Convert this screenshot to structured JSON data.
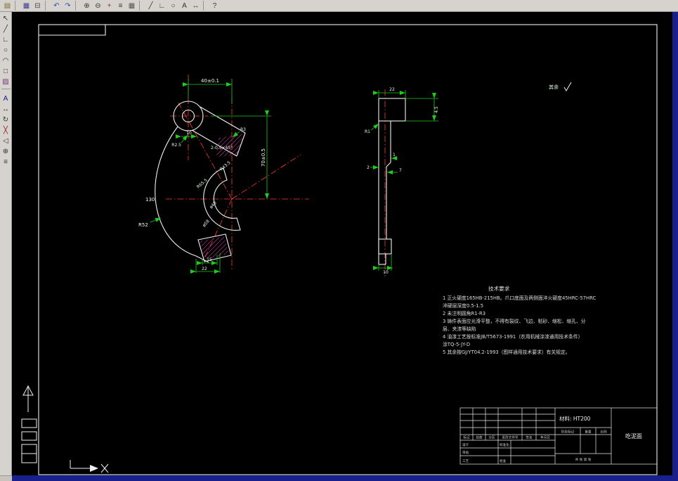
{
  "app": {
    "canvas_bg": "#000000",
    "toolbar_bg": "#d6d3ce",
    "window_edge_color": "#1a1f8e",
    "outline_color": "#f0f0f0",
    "dimension_color": "#1ecb1e",
    "centerline_color": "#ff3b30",
    "hatch_color": "#ff4fd1"
  },
  "toolbar_top": {
    "icons": [
      {
        "name": "open-icon",
        "glyph": "▤",
        "color": "#7a6a2a"
      },
      {
        "name": "separator"
      },
      {
        "name": "save-icon",
        "glyph": "▦",
        "color": "#3a3a8c"
      },
      {
        "name": "print-icon",
        "glyph": "⊟",
        "color": "#44475a"
      },
      {
        "name": "separator"
      },
      {
        "name": "undo-icon",
        "glyph": "↶",
        "color": "#2a52be"
      },
      {
        "name": "redo-icon",
        "glyph": "↷",
        "color": "#2a52be"
      },
      {
        "name": "separator"
      },
      {
        "name": "zoom-in-icon",
        "glyph": "⊕",
        "color": "#333333"
      },
      {
        "name": "zoom-out-icon",
        "glyph": "⊖",
        "color": "#333333"
      },
      {
        "name": "pan-icon",
        "glyph": "+",
        "color": "#a03333"
      },
      {
        "name": "layers-icon",
        "glyph": "≡",
        "color": "#333333"
      },
      {
        "name": "grid-icon",
        "glyph": "▦",
        "color": "#555555"
      },
      {
        "name": "separator"
      },
      {
        "name": "line-icon",
        "glyph": "╱",
        "color": "#333333"
      },
      {
        "name": "polyline-icon",
        "glyph": "∟",
        "color": "#333333"
      },
      {
        "name": "circle-icon",
        "glyph": "○",
        "color": "#333333"
      },
      {
        "name": "text-icon",
        "glyph": "A",
        "color": "#333333"
      },
      {
        "name": "dimension-icon",
        "glyph": "↔",
        "color": "#333333"
      },
      {
        "name": "separator"
      },
      {
        "name": "help-icon",
        "glyph": "?",
        "color": "#333333"
      }
    ]
  },
  "toolbar_left": {
    "icons": [
      {
        "name": "select-icon",
        "glyph": "↖",
        "color": "#333333"
      },
      {
        "name": "line-tool-icon",
        "glyph": "╱",
        "color": "#333333"
      },
      {
        "name": "polyline-tool-icon",
        "glyph": "∟",
        "color": "#333333"
      },
      {
        "name": "circle-tool-icon",
        "glyph": "○",
        "color": "#333333"
      },
      {
        "name": "arc-tool-icon",
        "glyph": "◠",
        "color": "#333333"
      },
      {
        "name": "rect-tool-icon",
        "glyph": "□",
        "color": "#333333"
      },
      {
        "name": "hatch-tool-icon",
        "glyph": "▨",
        "color": "#7a3a7a"
      },
      {
        "name": "separator"
      },
      {
        "name": "text-tool-icon",
        "glyph": "A",
        "color": "#1a1a8c"
      },
      {
        "name": "move-tool-icon",
        "glyph": "↔",
        "color": "#333333"
      },
      {
        "name": "rotate-tool-icon",
        "glyph": "↻",
        "color": "#333333"
      },
      {
        "name": "erase-tool-icon",
        "glyph": "╳",
        "color": "#8c1a1a"
      },
      {
        "name": "mirror-tool-icon",
        "glyph": "◁",
        "color": "#333333"
      },
      {
        "name": "zoom-tool-icon",
        "glyph": "⊕",
        "color": "#333333"
      },
      {
        "name": "props-tool-icon",
        "glyph": "≡",
        "color": "#333333"
      }
    ]
  },
  "drawing": {
    "front_view": {
      "labels": {
        "d40": "40±0.1",
        "d10": "10",
        "r3": "R3",
        "r25": "R2.5",
        "chamfer": "2-0.5×45°",
        "d70": "70±0.5",
        "r435": "R43.5",
        "r655": "R65.5",
        "dia40": "ø40",
        "dia58": "ø58",
        "d130": "130",
        "r52": "R52",
        "d15": "15",
        "d22": "22"
      }
    },
    "side_view": {
      "labels": {
        "d22": "22",
        "d45": "4.5",
        "r1": "R1",
        "d1": "1",
        "d2": "2",
        "d7": "7",
        "d10": "10"
      }
    },
    "surface_note": {
      "text": "其余"
    },
    "tech_requirements": {
      "title": "技术要求",
      "lines": [
        "1 正火硬度165HB-215HB。爪口底面及两侧面淬火硬度45HRC-57HRC",
        "  淬硬层深度0.5-1.5",
        "2 未注明圆角R1-R3",
        "3 铸件表面应光滑平整，不得有裂纹、飞边、粘砂、缩松、缩孔、分",
        "  层、夹渣等缺陷",
        "4 油漆工艺按标准JB/T5673-1991（农用机械涂漆通用技术条件）",
        "  涂TQ-5-JY-D",
        "5 其余按GJ/YT04.2-1993（图样通用技术要求）有关规定。"
      ]
    },
    "title_block": {
      "material": "材料: HT200",
      "part_name": "吃泥面",
      "header_cols": [
        "标记",
        "处数",
        "分区",
        "更改文件号",
        "签名",
        "年月日"
      ],
      "role_design": "设计",
      "role_standard": "标准化",
      "role_check": "审核",
      "role_process": "工艺",
      "role_approve": "批准",
      "stage_cols": [
        "阶段标记",
        "重量",
        "比例"
      ],
      "sheet_note": "共  张  第  张"
    }
  }
}
